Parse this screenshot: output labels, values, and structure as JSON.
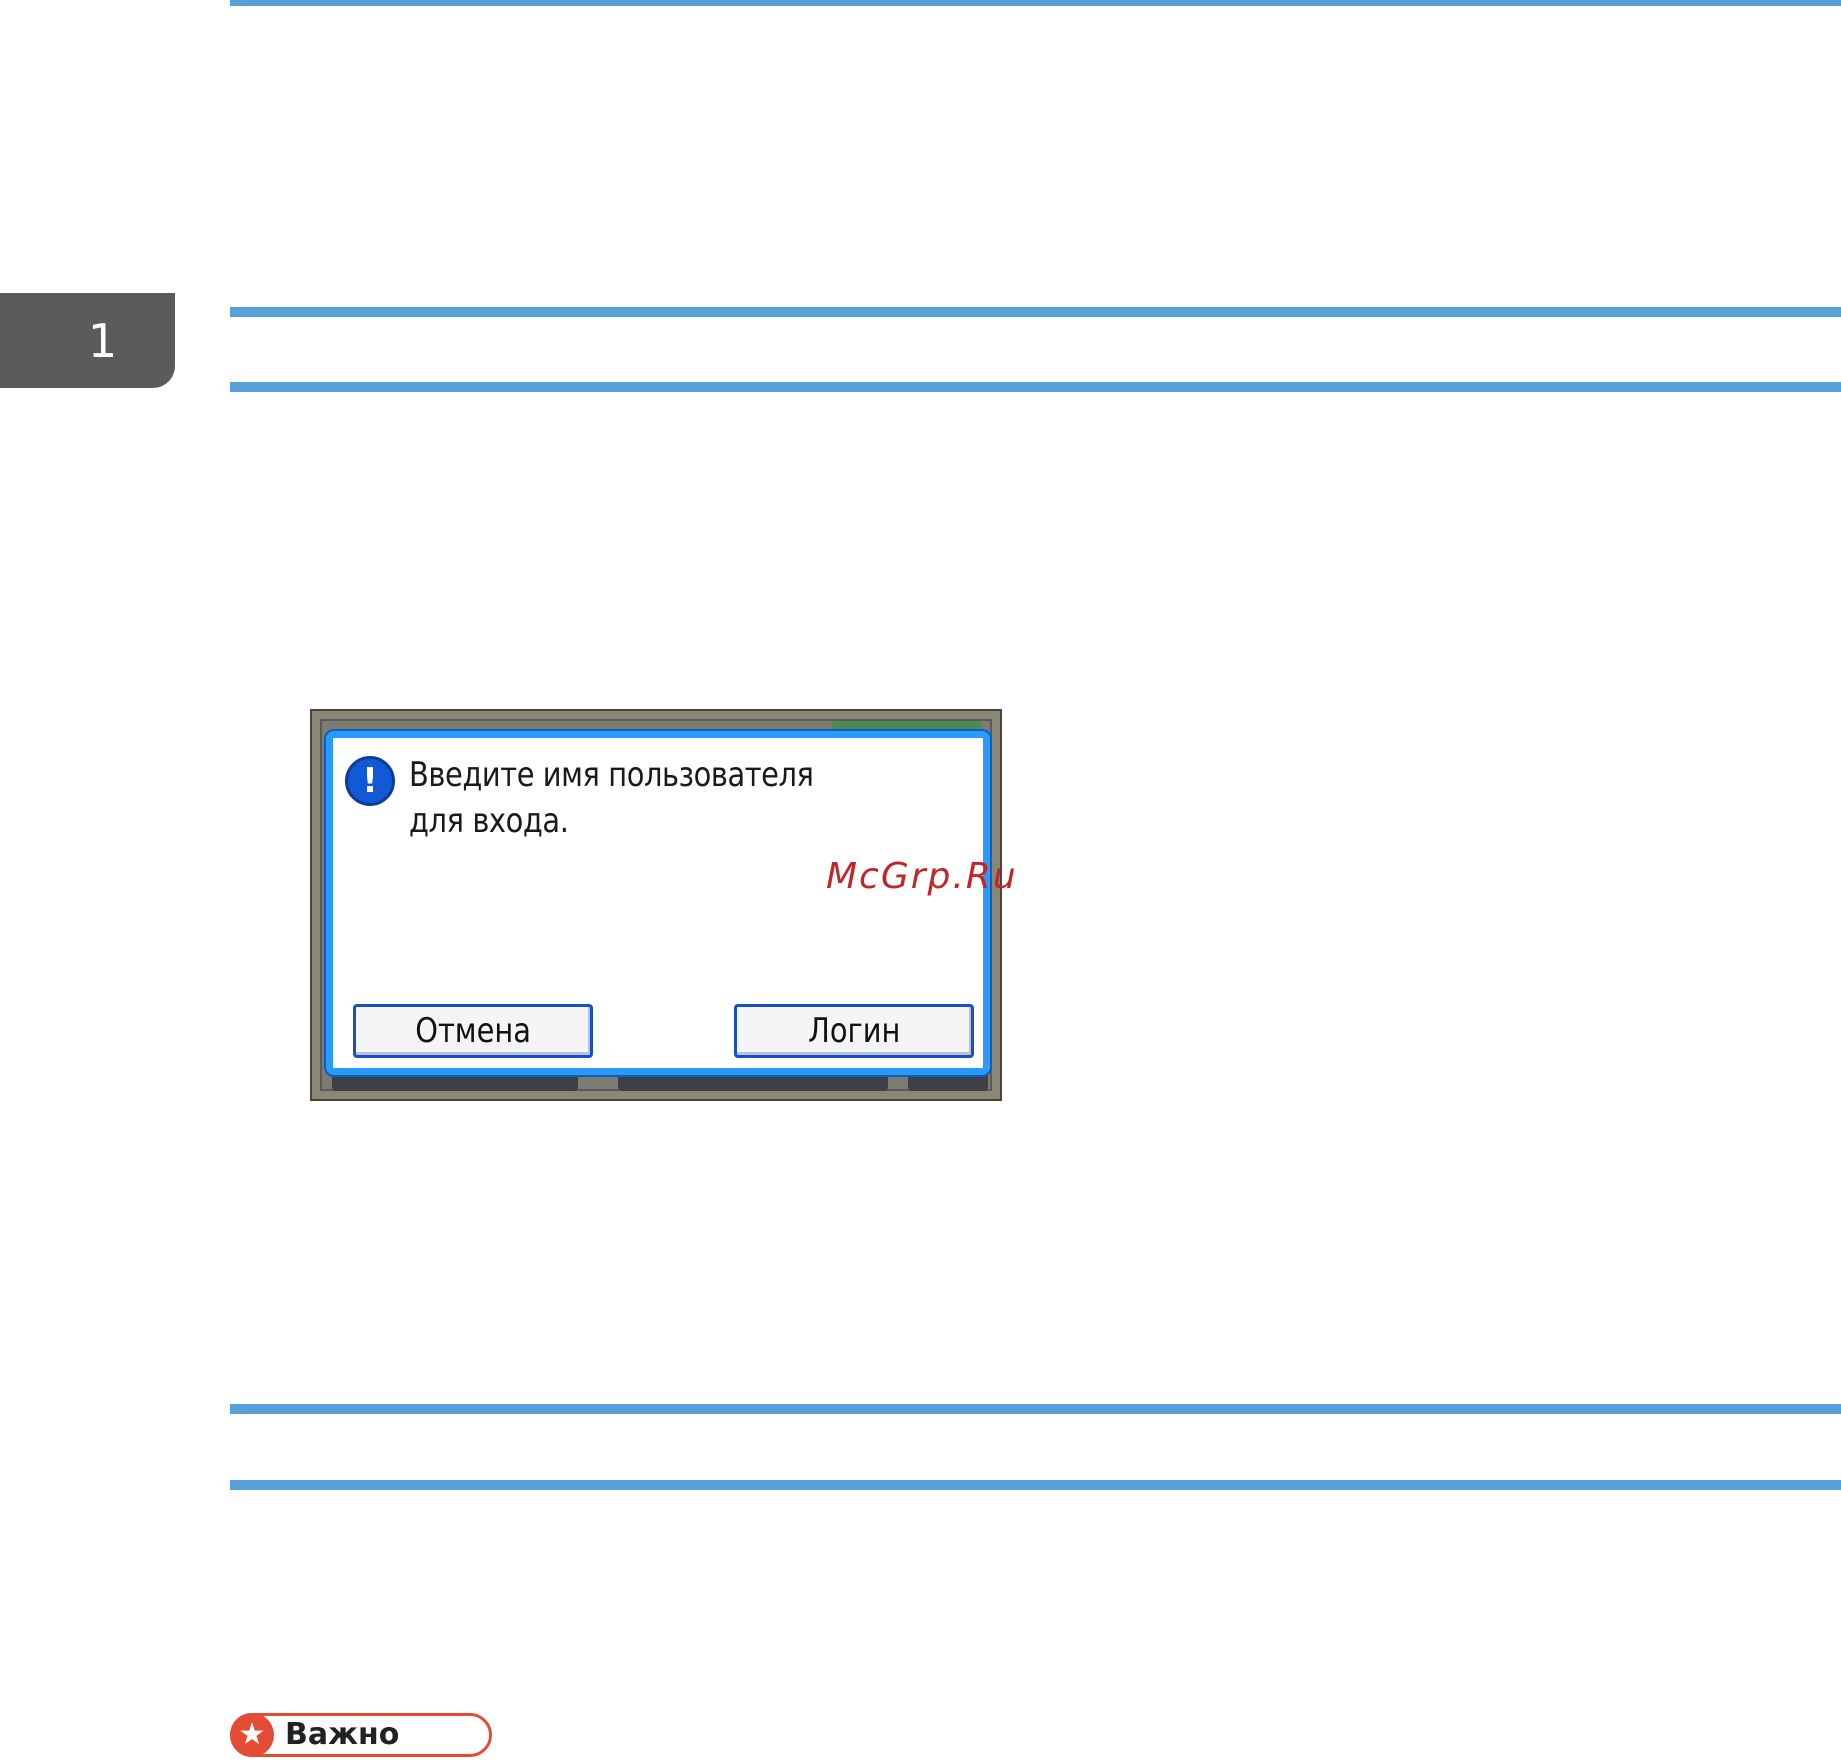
{
  "chapter": {
    "number": "1"
  },
  "dialog": {
    "message": "Введите имя пользователя для входа.",
    "cancel_label": "Отмена",
    "login_label": "Логин",
    "icon": "exclamation-icon"
  },
  "watermark": {
    "text": "McGrp.Ru"
  },
  "notice": {
    "label": "Важно",
    "icon": "star-icon"
  },
  "colors": {
    "rule": "#5aa0d8",
    "tab": "#5b5b5b",
    "dialog_border": "#2b9aff",
    "important": "#e34b35",
    "watermark": "#c0262c"
  }
}
